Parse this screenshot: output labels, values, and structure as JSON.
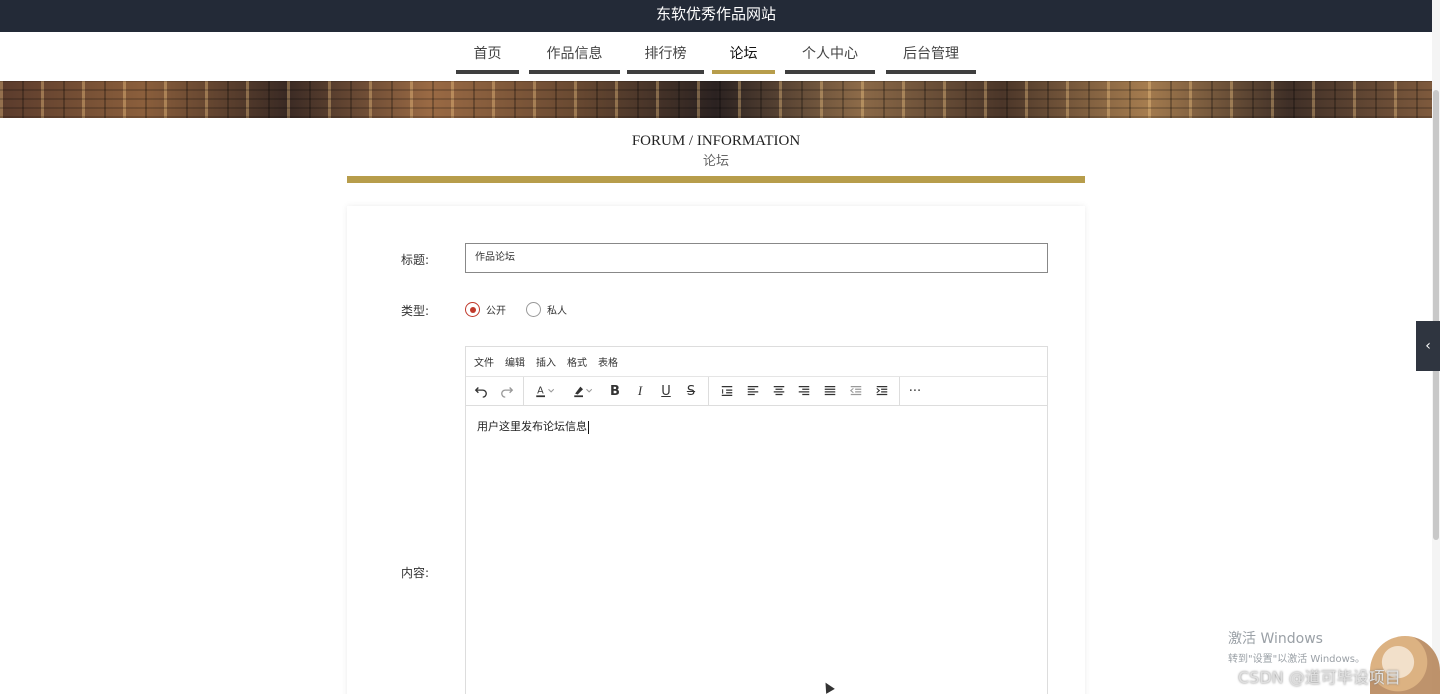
{
  "site": {
    "title": "东软优秀作品网站"
  },
  "nav": {
    "items": [
      {
        "label": "首页",
        "active": false
      },
      {
        "label": "作品信息",
        "active": false
      },
      {
        "label": "排行榜",
        "active": false
      },
      {
        "label": "论坛",
        "active": true
      },
      {
        "label": "个人中心",
        "active": false
      },
      {
        "label": "后台管理",
        "active": false
      }
    ]
  },
  "section": {
    "title_en": "FORUM / INFORMATION",
    "title_cn": "论坛"
  },
  "form": {
    "title_label": "标题:",
    "title_value": "作品论坛",
    "type_label": "类型:",
    "type_options": [
      {
        "label": "公开",
        "checked": true
      },
      {
        "label": "私人",
        "checked": false
      }
    ],
    "content_label": "内容:"
  },
  "editor": {
    "menus": [
      "文件",
      "编辑",
      "插入",
      "格式",
      "表格"
    ],
    "toolbar_icons": [
      "undo-icon",
      "redo-icon",
      "font-color-icon",
      "highlight-icon",
      "bold-icon",
      "italic-icon",
      "underline-icon",
      "strikethrough-icon",
      "line-height-icon",
      "align-left-icon",
      "align-center-icon",
      "align-right-icon",
      "align-justify-icon",
      "outdent-icon",
      "indent-icon",
      "more-icon"
    ],
    "content": "用户这里发布论坛信息"
  },
  "watermark": {
    "line1": "激活 Windows",
    "line2": "转到\"设置\"以激活 Windows。"
  },
  "csdn": "CSDN @道可毕设项目",
  "colors": {
    "topbar": "#232a37",
    "accent": "#b79d4b",
    "radio": "#c0392b"
  }
}
